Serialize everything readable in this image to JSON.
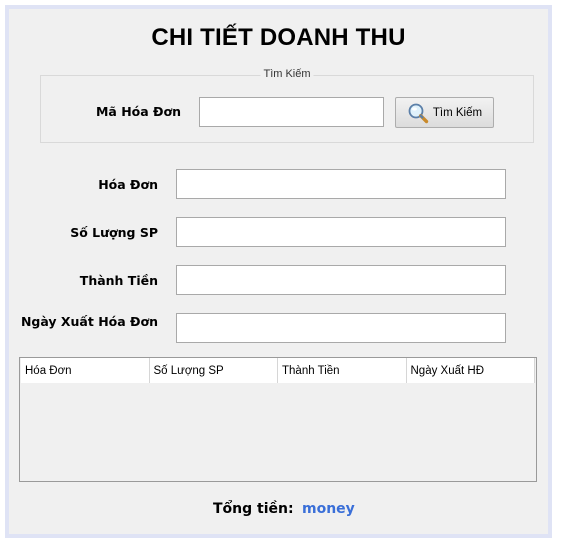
{
  "title": "CHI TIẾT DOANH THU",
  "search": {
    "group_label": "Tìm Kiếm",
    "invoice_code_label": "Mã Hóa Đơn",
    "invoice_code_value": "",
    "button_label": "Tìm Kiếm",
    "button_icon": "magnifier-icon"
  },
  "form": {
    "invoice_label": "Hóa Đơn",
    "invoice_value": "",
    "quantity_label": "Số Lượng SP",
    "quantity_value": "",
    "amount_label": "Thành Tiền",
    "amount_value": "",
    "date_label": "Ngày Xuất Hóa Đơn",
    "date_value": ""
  },
  "table": {
    "columns": [
      "Hóa Đơn",
      "Số Lượng SP",
      "Thành Tiền",
      "Ngày Xuất HĐ"
    ],
    "rows": []
  },
  "total": {
    "label": "Tổng tiền:",
    "value": "money",
    "value_color": "#3a6fd8"
  }
}
